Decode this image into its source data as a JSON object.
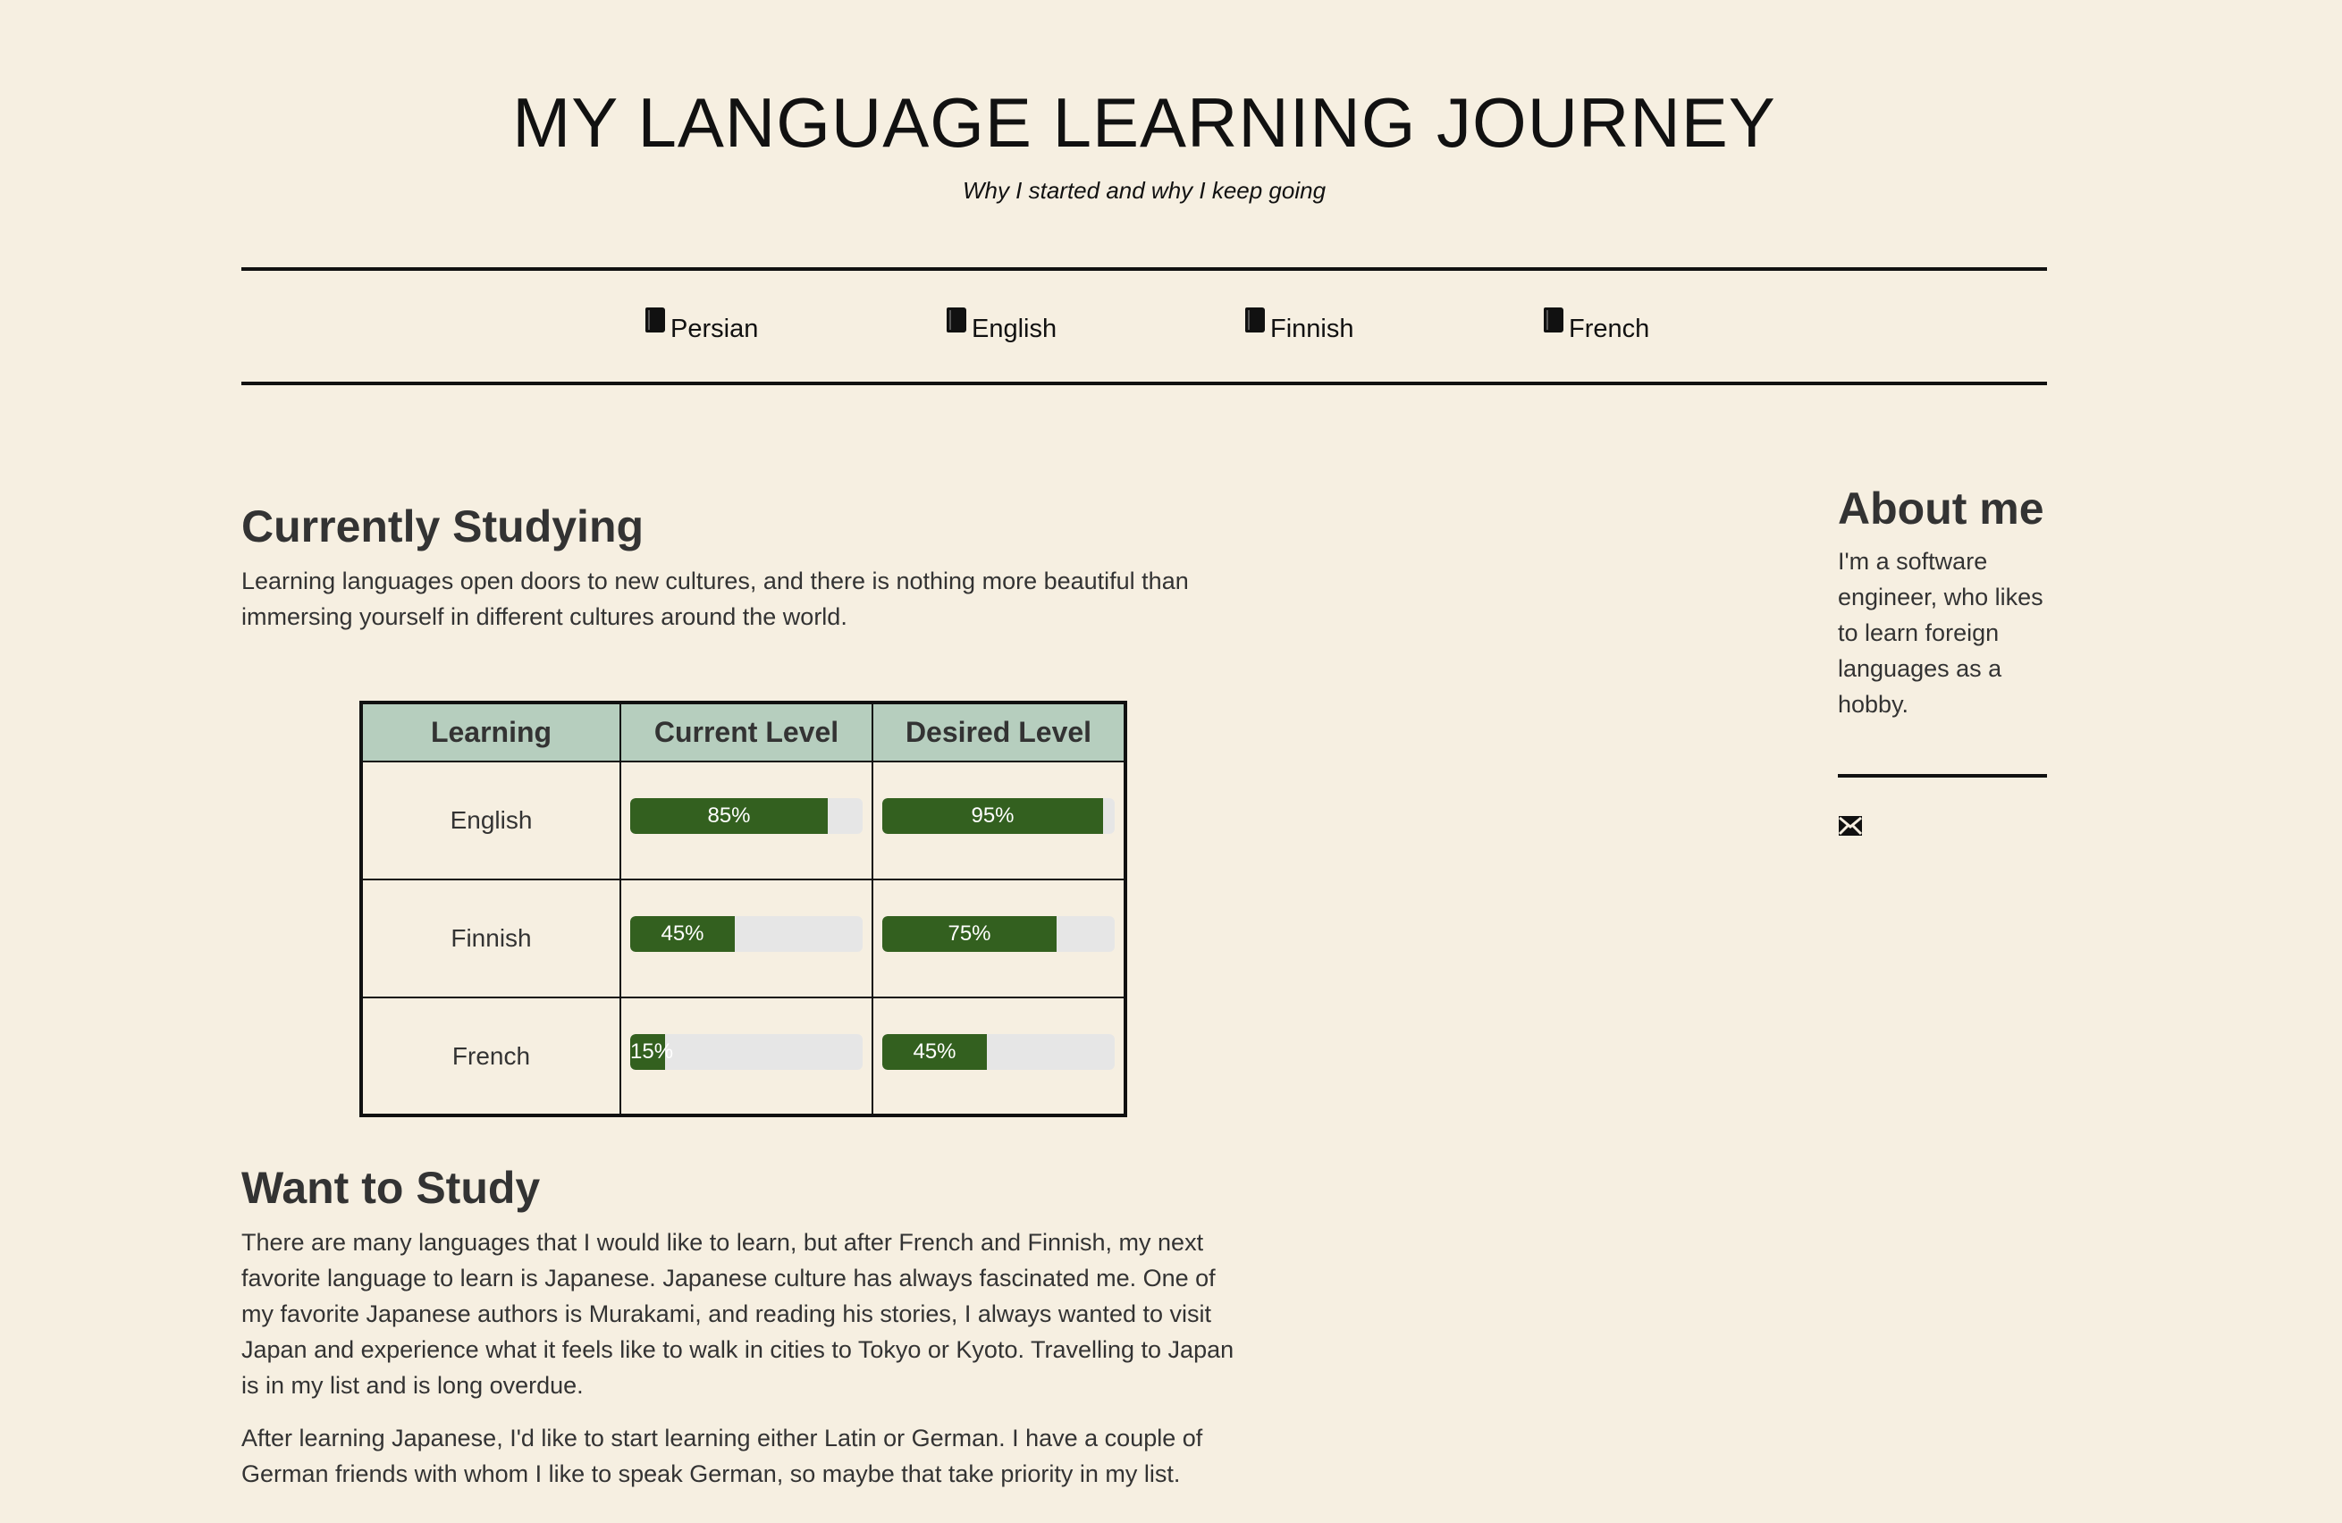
{
  "header": {
    "title": "MY LANGUAGE LEARNING JOURNEY",
    "subtitle": "Why I started and why I keep going"
  },
  "nav": {
    "items": [
      {
        "label": "Persian",
        "icon": "book-icon"
      },
      {
        "label": "English",
        "icon": "book-icon"
      },
      {
        "label": "Finnish",
        "icon": "book-icon"
      },
      {
        "label": "French",
        "icon": "book-icon"
      }
    ]
  },
  "currently": {
    "title": "Currently Studying",
    "intro": "Learning languages open doors to new cultures, and there is nothing more beautiful than immersing yourself in different cultures around the world."
  },
  "table": {
    "headers": [
      "Learning",
      "Current Level",
      "Desired Level"
    ],
    "rows": [
      {
        "language": "English",
        "current": 85,
        "current_label": "85%",
        "desired": 95,
        "desired_label": "95%"
      },
      {
        "language": "Finnish",
        "current": 45,
        "current_label": "45%",
        "desired": 75,
        "desired_label": "75%"
      },
      {
        "language": "French",
        "current": 15,
        "current_label": "15%",
        "desired": 45,
        "desired_label": "45%"
      }
    ]
  },
  "want": {
    "title": "Want to Study",
    "paragraphs": [
      "There are many languages that I would like to learn, but after French and Finnish, my next favorite language to learn is Japanese. Japanese culture has always fascinated me. One of my favorite Japanese authors is Murakami, and reading his stories, I always wanted to visit Japan and experience what it feels like to walk in cities to Tokyo or Kyoto. Travelling to Japan is in my list and is long overdue.",
      "After learning Japanese, I'd like to start learning either Latin or German. I have a couple of German friends with whom I like to speak German, so maybe that take priority in my list."
    ]
  },
  "about": {
    "title": "About me",
    "text": "I'm a software engineer, who likes to learn foreign languages as a hobby.",
    "contact_icon": "mail-icon"
  },
  "colors": {
    "background": "#f6efe1",
    "table_header": "#b6cebe",
    "bar_fill": "#33601f",
    "bar_track": "#e6e6e6"
  }
}
